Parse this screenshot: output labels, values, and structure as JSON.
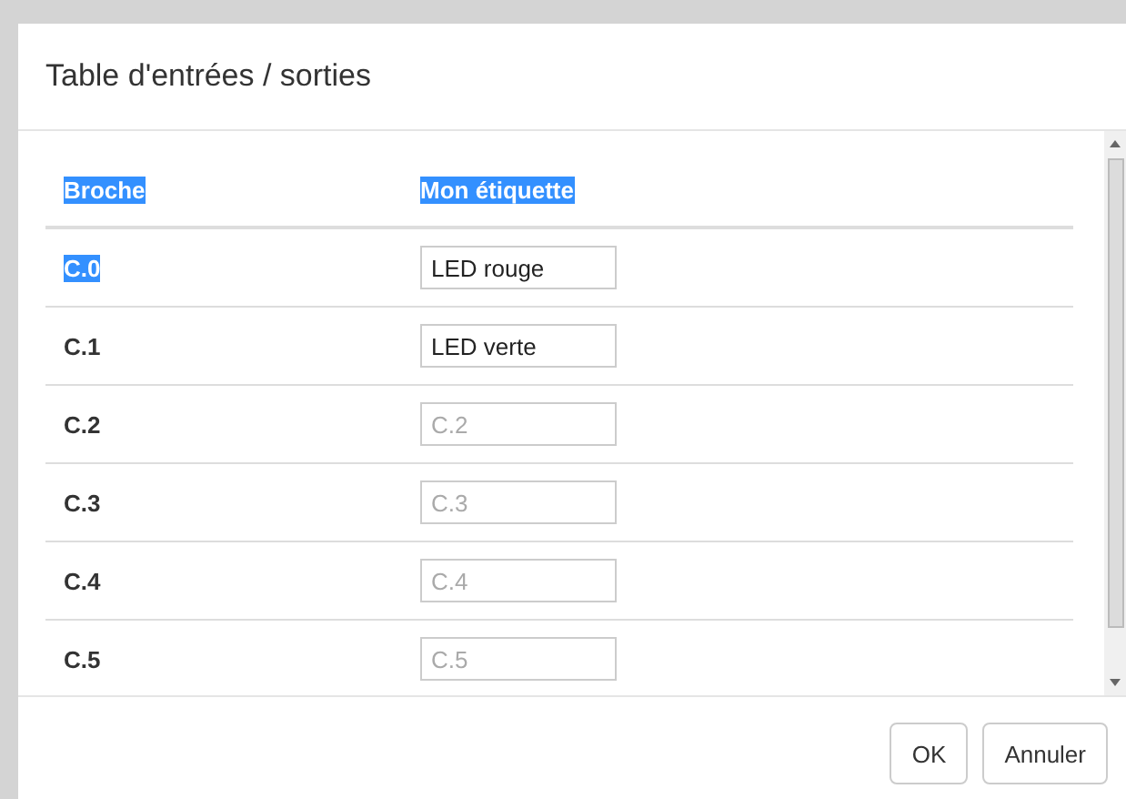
{
  "dialog": {
    "title": "Table d'entrées / sorties"
  },
  "table": {
    "columns": [
      {
        "label": "Broche",
        "highlighted": true
      },
      {
        "label": "Mon étiquette",
        "highlighted": true
      }
    ],
    "rows": [
      {
        "pin": "C.0",
        "highlighted": true,
        "value": "LED rouge"
      },
      {
        "pin": "C.1",
        "highlighted": false,
        "value": "LED verte"
      },
      {
        "pin": "C.2",
        "highlighted": false,
        "placeholder": "C.2"
      },
      {
        "pin": "C.3",
        "highlighted": false,
        "placeholder": "C.3"
      },
      {
        "pin": "C.4",
        "highlighted": false,
        "placeholder": "C.4"
      },
      {
        "pin": "C.5",
        "highlighted": false,
        "placeholder": "C.5"
      }
    ]
  },
  "buttons": [
    "OK",
    "Annuler"
  ]
}
